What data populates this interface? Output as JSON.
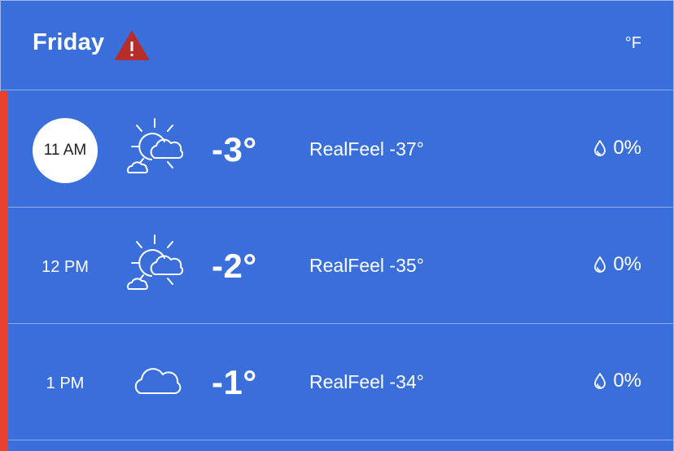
{
  "header": {
    "day": "Friday",
    "unit": "°F",
    "alert_icon": "warning-triangle-icon",
    "alert_color": "#b62d2a"
  },
  "colors": {
    "background": "#3a6fdb",
    "accent_bar": "#e8412f",
    "divider": "#8eabe9",
    "bubble": "#ffffff"
  },
  "hours": [
    {
      "time": "11 AM",
      "selected": true,
      "icon": "partly-sunny-icon",
      "temp": "-3°",
      "realfeel": "RealFeel -37°",
      "precip": "0%"
    },
    {
      "time": "12 PM",
      "selected": false,
      "icon": "partly-sunny-icon",
      "temp": "-2°",
      "realfeel": "RealFeel -35°",
      "precip": "0%"
    },
    {
      "time": "1 PM",
      "selected": false,
      "icon": "cloud-icon",
      "temp": "-1°",
      "realfeel": "RealFeel -34°",
      "precip": "0%"
    }
  ]
}
